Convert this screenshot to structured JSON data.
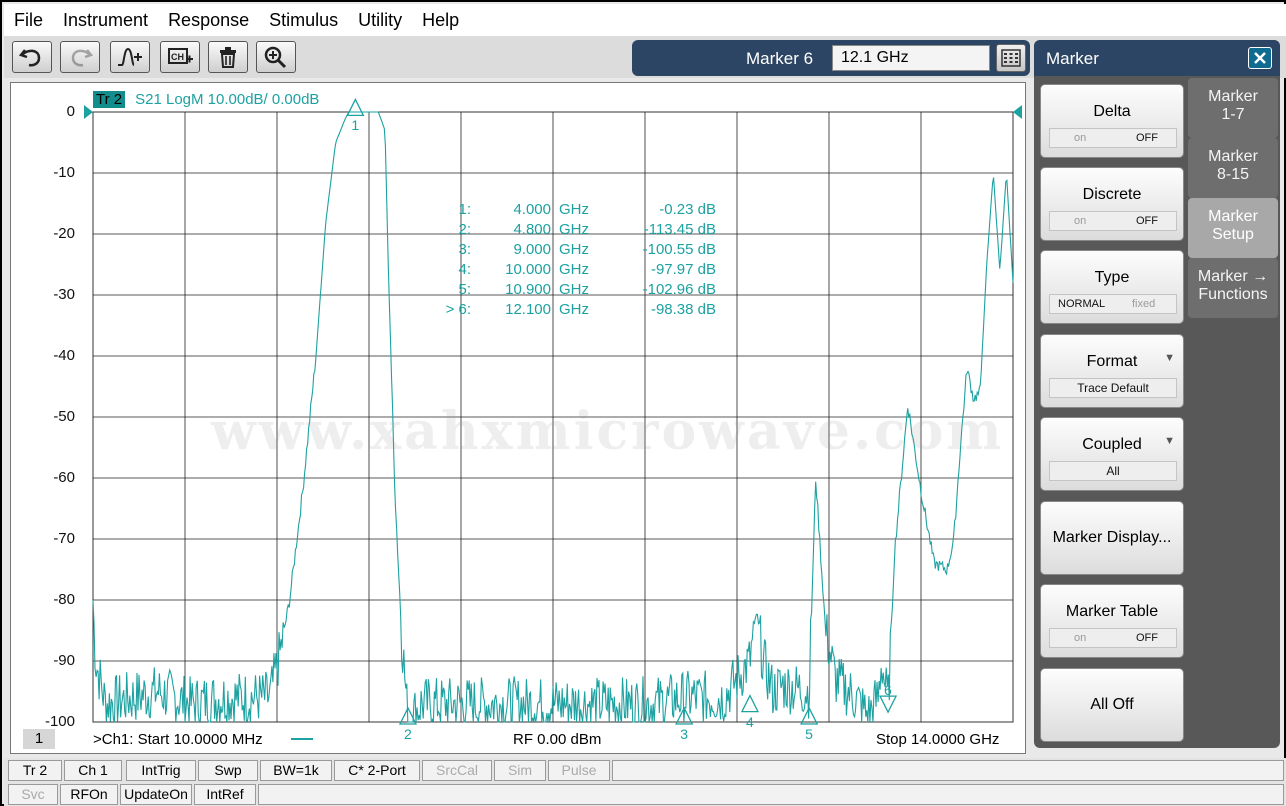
{
  "menu": [
    "File",
    "Instrument",
    "Response",
    "Stimulus",
    "Utility",
    "Help"
  ],
  "toolbar": {
    "buttons": [
      "undo-icon",
      "redo-icon",
      "add-trace-icon",
      "add-channel-icon",
      "delete-icon",
      "zoom-icon"
    ],
    "marker_label": "Marker 6",
    "marker_value": "12.1 GHz"
  },
  "trace": {
    "tag": "Tr 2",
    "info": "S21 LogM 10.00dB/  0.00dB",
    "color": "#1da1a1"
  },
  "y_ticks": [
    "0",
    "-10",
    "-20",
    "-30",
    "-40",
    "-50",
    "-60",
    "-70",
    "-80",
    "-90",
    "-100"
  ],
  "watermark": "www.xahxmicrowave.com",
  "marker_readout": [
    {
      "id": "1:",
      "freq": "4.000",
      "unit": "GHz",
      "val": "-0.23 dB"
    },
    {
      "id": "2:",
      "freq": "4.800",
      "unit": "GHz",
      "val": "-113.45 dB"
    },
    {
      "id": "3:",
      "freq": "9.000",
      "unit": "GHz",
      "val": "-100.55 dB"
    },
    {
      "id": "4:",
      "freq": "10.000",
      "unit": "GHz",
      "val": "-97.97 dB"
    },
    {
      "id": "5:",
      "freq": "10.900",
      "unit": "GHz",
      "val": "-102.96 dB"
    },
    {
      "id": "> 6:",
      "freq": "12.100",
      "unit": "GHz",
      "val": "-98.38 dB"
    }
  ],
  "markers_on_trace": [
    "1",
    "2",
    "3",
    "4",
    "5",
    "6"
  ],
  "channel_badge": "1",
  "footer": {
    "start": ">Ch1:  Start   10.0000 MHz",
    "rf": "RF    0.00 dBm",
    "stop": "Stop  14.0000 GHz"
  },
  "chart_data": {
    "type": "line",
    "title": "",
    "xlabel": "",
    "ylabel": "",
    "x_start_ghz": 0.01,
    "x_stop_ghz": 14.0,
    "ylim": [
      -100,
      0
    ],
    "grid": true,
    "series": [
      {
        "values_x_ghz": [
          0.01,
          0.05,
          0.2,
          0.6,
          1.0,
          1.5,
          2.0,
          2.7,
          2.85,
          3.0,
          3.2,
          3.4,
          3.55,
          3.7,
          3.85,
          3.9,
          4.0,
          4.1,
          4.2,
          4.35,
          4.45,
          4.5,
          4.6,
          4.7,
          4.8,
          5.0,
          5.5,
          6.5,
          7.5,
          8.5,
          9.0,
          9.6,
          10.0,
          10.1,
          10.2,
          10.35,
          10.5,
          10.9,
          11.0,
          11.15,
          11.3,
          11.6,
          11.8,
          11.95,
          12.0,
          12.1,
          12.2,
          12.4,
          12.6,
          12.8,
          13.0,
          13.1,
          13.2,
          13.3,
          13.4,
          13.5,
          13.6,
          13.7,
          13.8,
          13.9,
          14.0
        ],
        "values_db": [
          -80,
          -90,
          -97,
          -96,
          -95,
          -97,
          -96,
          -96,
          -89,
          -80,
          -62,
          -40,
          -18,
          -5,
          -1,
          0,
          0,
          0,
          0,
          0,
          -3,
          -25,
          -62,
          -85,
          -100,
          -97,
          -97,
          -97,
          -97,
          -97,
          -96,
          -96,
          -90,
          -82,
          -90,
          -95,
          -94,
          -95,
          -60,
          -85,
          -93,
          -96,
          -99,
          -96,
          -90,
          -97,
          -72,
          -48,
          -62,
          -74,
          -75,
          -70,
          -55,
          -42,
          -47,
          -46,
          -25,
          -10,
          -26,
          -10,
          -28
        ]
      }
    ]
  },
  "side_panel": {
    "title": "Marker",
    "buttons": [
      {
        "label": "Delta",
        "opt1": "on",
        "opt2": "OFF"
      },
      {
        "label": "Discrete",
        "opt1": "on",
        "opt2": "OFF"
      },
      {
        "label": "Type",
        "opt1": "NORMAL",
        "opt2": "fixed"
      },
      {
        "label": "Format",
        "value": "Trace Default"
      },
      {
        "label": "Coupled",
        "value": "All"
      },
      {
        "label": "Marker Display..."
      },
      {
        "label": "Marker Table",
        "opt1": "on",
        "opt2": "OFF"
      },
      {
        "label": "All Off"
      }
    ],
    "tabs": [
      {
        "line1": "Marker",
        "line2": "1-7"
      },
      {
        "line1": "Marker",
        "line2": "8-15"
      },
      {
        "line1": "Marker",
        "line2": "Setup"
      },
      {
        "line1": "Marker →",
        "line2": "Functions"
      }
    ]
  },
  "status_row1": [
    "Tr 2",
    "Ch 1",
    "IntTrig",
    "Swp",
    "BW=1k",
    "C* 2-Port",
    "SrcCal",
    "Sim",
    "Pulse"
  ],
  "status_row2": [
    "Svc",
    "RFOn",
    "UpdateOn",
    "IntRef"
  ]
}
